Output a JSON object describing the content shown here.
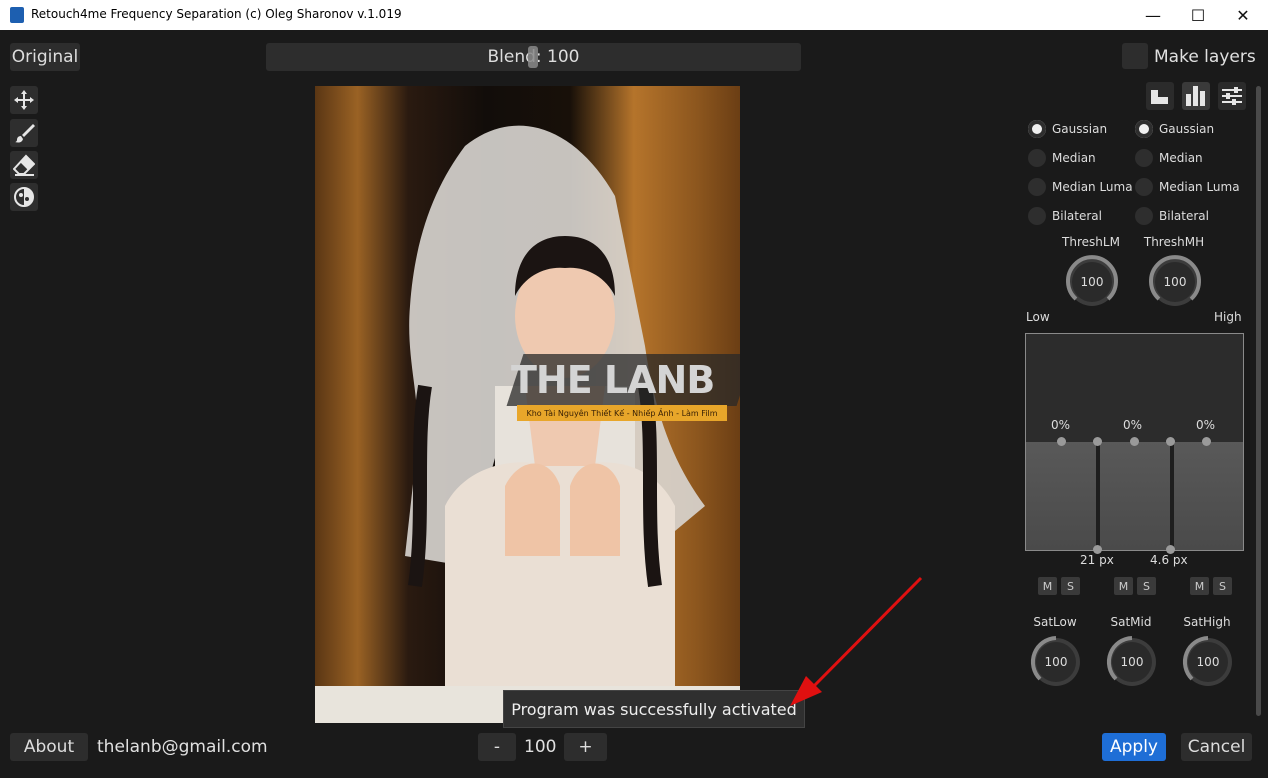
{
  "window": {
    "title": "Retouch4me Frequency Separation (c) Oleg Sharonov v.1.019",
    "minimize": "—",
    "maximize": "☐",
    "close": "✕"
  },
  "top": {
    "original": "Original",
    "blend": "Blend: 100",
    "make_layers": "Make layers"
  },
  "left_tools": [
    "move-tool",
    "brush-tool",
    "eraser-tool",
    "fill-tool"
  ],
  "watermark": {
    "title": "THE LANB",
    "subtitle": "Kho Tài Nguyên Thiết Kế - Nhiếp Ảnh - Làm Film"
  },
  "filters": {
    "left": [
      {
        "label": "Gaussian",
        "selected": true
      },
      {
        "label": "Median",
        "selected": false
      },
      {
        "label": "Median Luma",
        "selected": false
      },
      {
        "label": "Bilateral",
        "selected": false
      }
    ],
    "right": [
      {
        "label": "Gaussian",
        "selected": true
      },
      {
        "label": "Median",
        "selected": false
      },
      {
        "label": "Median Luma",
        "selected": false
      },
      {
        "label": "Bilateral",
        "selected": false
      }
    ]
  },
  "thresholds": [
    {
      "label": "ThreshLM",
      "value": "100"
    },
    {
      "label": "ThreshMH",
      "value": "100"
    }
  ],
  "freq": {
    "low": "Low",
    "high": "High",
    "bands": [
      {
        "pct": "0%",
        "level": 0
      },
      {
        "pct": "0%",
        "level": 0
      },
      {
        "pct": "0%",
        "level": 0
      }
    ],
    "split1": "21 px",
    "split2": "4.6 px"
  },
  "ms": {
    "m": "M",
    "s": "S"
  },
  "saturation": [
    {
      "label": "SatLow",
      "value": "100"
    },
    {
      "label": "SatMid",
      "value": "100"
    },
    {
      "label": "SatHigh",
      "value": "100"
    }
  ],
  "toast": "Program was successfully activated",
  "bottom": {
    "about": "About",
    "email": "thelanb@gmail.com",
    "minus": "-",
    "zoom": "100",
    "plus": "+",
    "apply": "Apply",
    "cancel": "Cancel"
  },
  "colors": {
    "accent": "#1e6ed6",
    "annotation_arrow": "#e01010"
  }
}
